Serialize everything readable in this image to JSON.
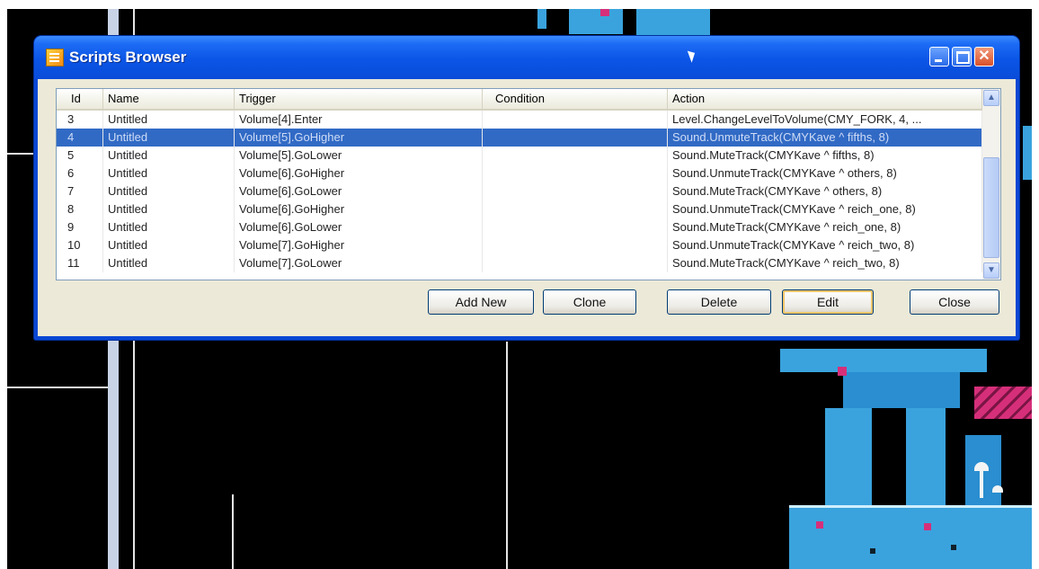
{
  "window": {
    "title": "Scripts Browser"
  },
  "columns": [
    "Id",
    "Name",
    "Trigger",
    "Condition",
    "Action"
  ],
  "rows": [
    {
      "id": "3",
      "name": "Untitled",
      "trigger": "Volume[4].Enter",
      "condition": "",
      "action": "Level.ChangeLevelToVolume(CMY_FORK, 4, ..."
    },
    {
      "id": "4",
      "name": "Untitled",
      "trigger": "Volume[5].GoHigher",
      "condition": "",
      "action": "Sound.UnmuteTrack(CMYKave ^ fifths, 8)",
      "selected": true
    },
    {
      "id": "5",
      "name": "Untitled",
      "trigger": "Volume[5].GoLower",
      "condition": "",
      "action": "Sound.MuteTrack(CMYKave ^ fifths, 8)"
    },
    {
      "id": "6",
      "name": "Untitled",
      "trigger": "Volume[6].GoHigher",
      "condition": "",
      "action": "Sound.UnmuteTrack(CMYKave ^ others, 8)"
    },
    {
      "id": "7",
      "name": "Untitled",
      "trigger": "Volume[6].GoLower",
      "condition": "",
      "action": "Sound.MuteTrack(CMYKave ^ others, 8)"
    },
    {
      "id": "8",
      "name": "Untitled",
      "trigger": "Volume[6].GoHigher",
      "condition": "",
      "action": "Sound.UnmuteTrack(CMYKave ^ reich_one, 8)"
    },
    {
      "id": "9",
      "name": "Untitled",
      "trigger": "Volume[6].GoLower",
      "condition": "",
      "action": "Sound.MuteTrack(CMYKave ^ reich_one, 8)"
    },
    {
      "id": "10",
      "name": "Untitled",
      "trigger": "Volume[7].GoHigher",
      "condition": "",
      "action": "Sound.UnmuteTrack(CMYKave ^ reich_two, 8)"
    },
    {
      "id": "11",
      "name": "Untitled",
      "trigger": "Volume[7].GoLower",
      "condition": "",
      "action": "Sound.MuteTrack(CMYKave ^ reich_two, 8)"
    }
  ],
  "buttons": {
    "add_new": "Add New",
    "clone": "Clone",
    "delete": "Delete",
    "edit": "Edit",
    "close": "Close"
  },
  "icons": {
    "window_icon": "scripts-window-icon",
    "minimize": "minimize-icon",
    "maximize": "maximize-icon",
    "close": "close-icon",
    "cursor": "mouse-cursor-icon"
  },
  "colors": {
    "title_bar": "#0a4cd8",
    "selection": "#316ac5",
    "level_blue": "#3aa3dd",
    "level_pink": "#d62f7a"
  }
}
